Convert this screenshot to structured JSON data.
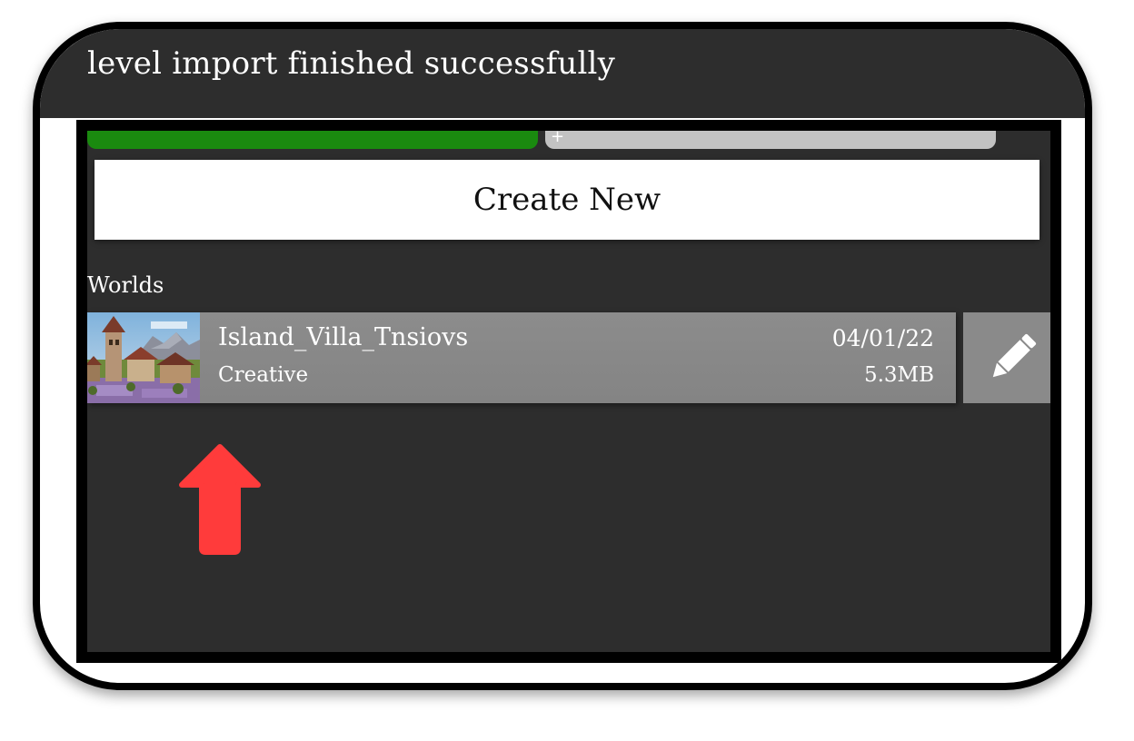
{
  "toast": {
    "message": "level import finished successfully"
  },
  "tabs": {
    "add_symbol": "+"
  },
  "create_new": {
    "label": "Create New"
  },
  "worlds_section": {
    "title": "Worlds",
    "items": [
      {
        "name": "Island_Villa_Tnsiovs",
        "mode": "Creative",
        "date": "04/01/22",
        "size": "5.3MB",
        "thumbnail": "village-landscape-thumbnail"
      }
    ]
  },
  "colors": {
    "active_tab": "#1a8a0f",
    "inactive_tab": "#c2c2c2",
    "background": "#2d2d2d",
    "row": "#8c8c8c",
    "arrow": "#ff3b3b"
  },
  "icons": {
    "edit": "pencil-icon",
    "annotation": "up-arrow-icon"
  }
}
